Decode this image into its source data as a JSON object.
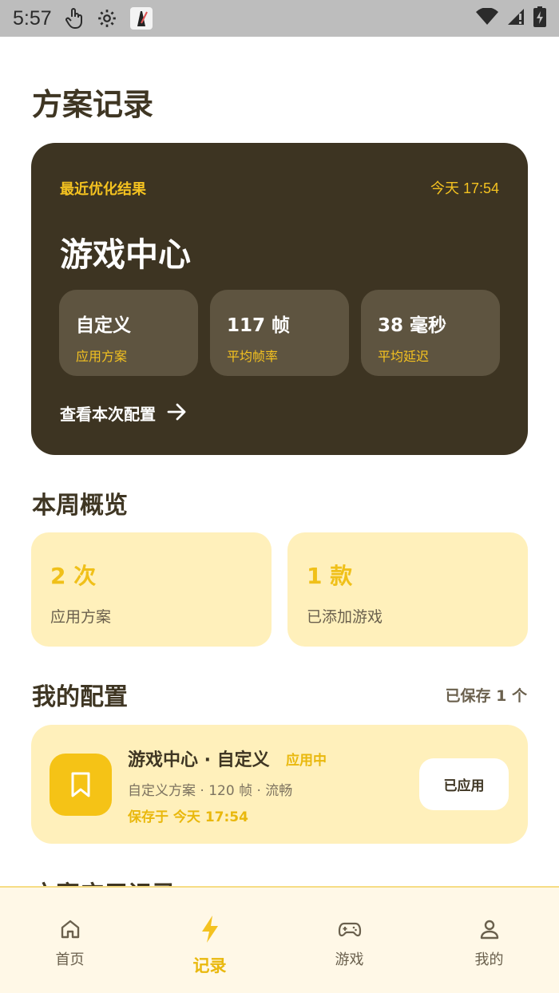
{
  "status_bar": {
    "time": "5:57"
  },
  "page": {
    "title": "方案记录"
  },
  "latest": {
    "label": "最近优化结果",
    "time": "今天 17:54",
    "game": "游戏中心",
    "stats": [
      {
        "value": "自定义",
        "label": "应用方案"
      },
      {
        "value": "117 帧",
        "label": "平均帧率"
      },
      {
        "value": "38 毫秒",
        "label": "平均延迟"
      }
    ],
    "link": "查看本次配置"
  },
  "overview": {
    "title": "本周概览",
    "cards": [
      {
        "value": "2 次",
        "label": "应用方案"
      },
      {
        "value": "1 款",
        "label": "已添加游戏"
      }
    ]
  },
  "configs": {
    "title": "我的配置",
    "saved_count": "已保存 1 个",
    "items": [
      {
        "name": "游戏中心 · 自定义",
        "status": "应用中",
        "desc": "自定义方案 · 120 帧 · 流畅",
        "saved_at": "保存于 今天 17:54",
        "button": "已应用"
      }
    ]
  },
  "next_section_peek": "方案应用记录",
  "bottom_nav": [
    {
      "label": "首页",
      "icon": "home-icon",
      "active": false
    },
    {
      "label": "记录",
      "icon": "lightning-icon",
      "active": true
    },
    {
      "label": "游戏",
      "icon": "gamepad-icon",
      "active": false
    },
    {
      "label": "我的",
      "icon": "person-icon",
      "active": false
    }
  ],
  "colors": {
    "accent": "#f4c220",
    "dark_card": "#3d3422",
    "light_card": "#fff0bb"
  }
}
